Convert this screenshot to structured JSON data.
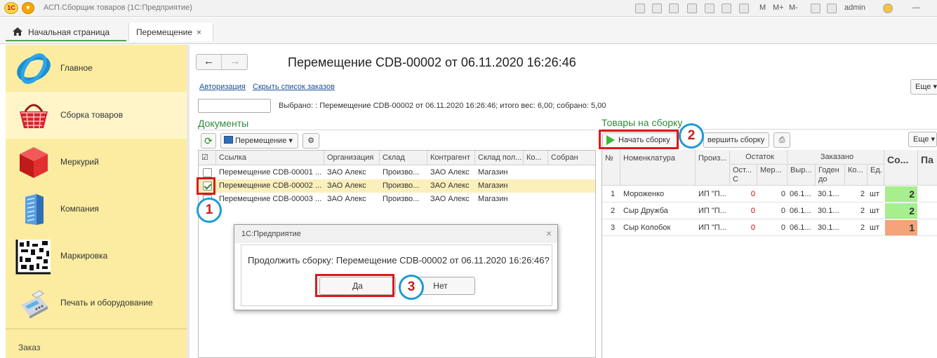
{
  "window": {
    "title": "АСП.Сборщик товаров  (1С:Предприятие)",
    "user": "admin",
    "memory_buttons": [
      "M",
      "M+",
      "M-"
    ]
  },
  "tabs": {
    "home": "Начальная страница",
    "document": "Перемещение",
    "close": "×"
  },
  "sidebar": {
    "items": [
      {
        "label": "Главное",
        "icon": "globe-icon"
      },
      {
        "label": "Сборка товаров",
        "icon": "shopping-basket-icon"
      },
      {
        "label": "Меркурий",
        "icon": "red-cube-icon"
      },
      {
        "label": "Компания",
        "icon": "office-building-icon"
      },
      {
        "label": "Маркировка",
        "icon": "datamatrix-icon"
      },
      {
        "label": "Печать и оборудование",
        "icon": "card-terminal-icon"
      }
    ],
    "bottom": "Заказ"
  },
  "header": {
    "back": "←",
    "forward": "→",
    "title": "Перемещение CDB-00002 от 06.11.2020 16:26:46"
  },
  "links": {
    "auth": "Авторизация",
    "hide_orders": "Скрыть список заказов"
  },
  "more_label": "Еще",
  "selected_info": "Выбрано: : Перемещение CDB-00002 от 06.11.2020 16:26:46; итого вес: 6,00; собрано: 5,00",
  "documents": {
    "title": "Документы",
    "filter": "Перемещение",
    "columns": [
      "Ссылка",
      "Организация",
      "Склад",
      "Контрагент",
      "Склад пол...",
      "Ко...",
      "Собран"
    ],
    "rows": [
      {
        "checked": false,
        "ref": "Перемещение CDB-00001 ...",
        "org": "ЗАО Алекс",
        "wh": "Произво...",
        "contr": "ЗАО Алекс",
        "dest": "Магазин",
        "k": "",
        "done": ""
      },
      {
        "checked": true,
        "ref": "Перемещение CDB-00002 ...",
        "org": "ЗАО Алекс",
        "wh": "Произво...",
        "contr": "ЗАО Алекс",
        "dest": "Магазин",
        "k": "",
        "done": ""
      },
      {
        "checked": false,
        "ref": "Перемещение CDB-00003 ...",
        "org": "ЗАО Алекс",
        "wh": "Произво...",
        "contr": "ЗАО Алекс",
        "dest": "Магазин",
        "k": "",
        "done": ""
      }
    ]
  },
  "goods": {
    "title": "Товары на сборку",
    "start": "Начать сборку",
    "finish": "вершить сборку",
    "headers": {
      "num": "№",
      "name": "Номенклатура",
      "maker": "Произ...",
      "stock": "Остаток",
      "stock_rest": "Ост... С",
      "stock_measure": "Мер...",
      "ordered": "Заказано",
      "ord_out": "Выр...",
      "ord_valid": "Годен до",
      "ord_qty": "Ко...",
      "ord_unit": "Ед.",
      "collected": "Со...",
      "extra": "Па"
    },
    "rows": [
      {
        "num": "1",
        "name": "Мороженко",
        "maker": "ИП \"П...",
        "rest": "0",
        "measure": "0",
        "out": "06.1...",
        "valid": "30.1...",
        "qty": "2",
        "unit": "шт",
        "collected": "2",
        "status": "#a6ee8e"
      },
      {
        "num": "2",
        "name": "Сыр Дружба",
        "maker": "ИП \"П...",
        "rest": "0",
        "measure": "0",
        "out": "06.1...",
        "valid": "30.1...",
        "qty": "2",
        "unit": "шт",
        "collected": "2",
        "status": "#a6ee8e"
      },
      {
        "num": "3",
        "name": "Сыр Колобок",
        "maker": "ИП \"П...",
        "rest": "0",
        "measure": "0",
        "out": "06.1...",
        "valid": "30.1...",
        "qty": "2",
        "unit": "шт",
        "collected": "1",
        "status": "#f4a37b"
      }
    ]
  },
  "dialog": {
    "title": "1С:Предприятие",
    "close": "×",
    "question": "Продолжить сборку: Перемещение CDB-00002 от 06.11.2020 16:26:46?",
    "yes": "Да",
    "no": "Нет"
  },
  "annotations": [
    "1",
    "2",
    "3"
  ],
  "colors": {
    "accent_green": "#2f8b3a",
    "sidebar": "#fbeca1",
    "selected_row": "#fbefbc",
    "annotation_red": "#d81b1b",
    "annotation_blue": "#1e9ad6"
  }
}
